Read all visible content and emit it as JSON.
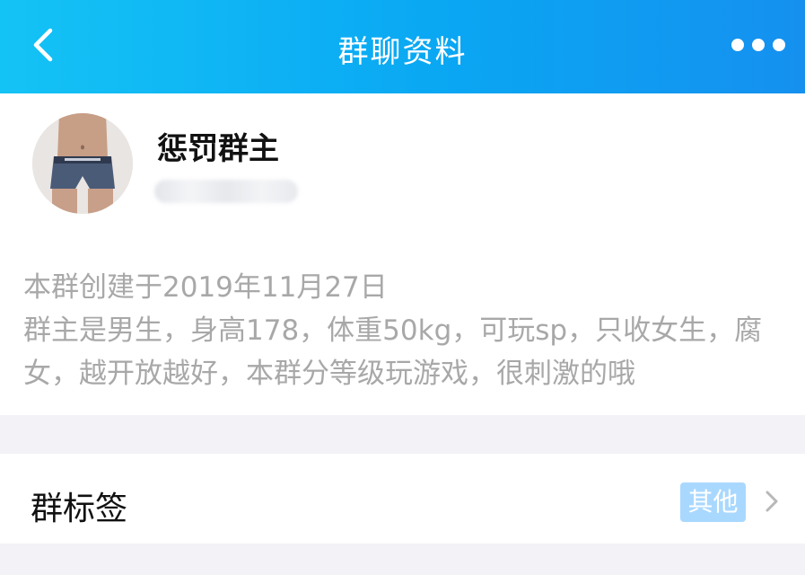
{
  "header": {
    "title": "群聊资料",
    "back_icon": "chevron-left-icon",
    "more_icon": "more-dots-icon",
    "gradient_colors": [
      "#14c3f5",
      "#0aa7f3",
      "#1590ef"
    ]
  },
  "group": {
    "name": "惩罚群主",
    "avatar": "avatar-photo",
    "description_lines": [
      "本群创建于2019年11月27日",
      "群主是男生，身高178，体重50kg，可玩sp，只收女生，腐",
      "女，越开放越好，本群分等级玩游戏，很刺激的哦"
    ]
  },
  "tag_row": {
    "label": "群标签",
    "tag": "其他",
    "chevron_icon": "chevron-right-icon",
    "tag_color": "#a9d8ff"
  }
}
